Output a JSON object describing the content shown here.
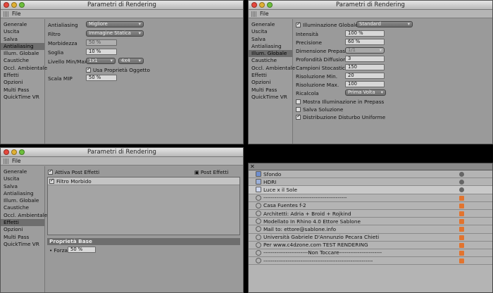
{
  "window_title": "Parametri di Rendering",
  "menu_file": "File",
  "sidebar": [
    "Generale",
    "Uscita",
    "Salva",
    "Antialiasing",
    "Illum. Globale",
    "Caustiche",
    "Occl. Ambientale",
    "Effetti",
    "Opzioni",
    "Multi Pass",
    "QuickTime VR"
  ],
  "win1": {
    "active": 3,
    "antialiasing_label": "Antialiasing",
    "antialiasing_value": "Migliore",
    "filtro_label": "Filtro",
    "filtro_value": "Immagine Statica",
    "morbidezza_label": "Morbidezza",
    "morbidezza_value": "50 %",
    "soglia_label": "Soglia",
    "soglia_value": "10 %",
    "livello_label": "Livello Min/Max",
    "livello_min": "1x1",
    "livello_max": "4x4",
    "usa_label": "Usa Proprietà Oggetto",
    "scala_label": "Scala MIP",
    "scala_value": "50 %"
  },
  "win2": {
    "active": 4,
    "illum_label": "Illuminazione Globale",
    "illum_value": "Standard",
    "intensita_label": "Intensità",
    "intensita_value": "100 %",
    "precisione_label": "Precisione",
    "precisione_value": "60 %",
    "dimensione_label": "Dimensione Prepass",
    "dimensione_value": "1/1",
    "profondita_label": "Profondità Diffusione",
    "profondita_value": "3",
    "campioni_label": "Campioni Stocastici",
    "campioni_value": "150",
    "rismin_label": "Risoluzione Min.",
    "rismin_value": "20",
    "rismax_label": "Risoluzione Max.",
    "rismax_value": "100",
    "ricalcola_label": "Ricalcola",
    "ricalcola_value": "Prima Volta",
    "mostra_label": "Mostra Illuminazione in Prepass",
    "salva_label": "Salva Soluzione",
    "distrib_label": "Distribuzione Disturbo Uniforme"
  },
  "win3": {
    "active": 7,
    "attiva_label": "Attiva Post Effetti",
    "post_effetti_btn": "Post Effetti",
    "filtro_morbido": "Filtro Morbido",
    "proprieta_base": "Proprietà Base",
    "forza_label": "Forza",
    "forza_value": "50 %"
  },
  "objects": [
    "Sfondo",
    "HDRI",
    "Luce x il Sole",
    "---------------------------------------------",
    "Casa Fuentes  f-2",
    "Architetti: Adria + Broid + Rojkind",
    "Modellato In Rhino 4.0  Ettore Sablone",
    "Mail to: ettore@sablone.info",
    "Università  Gabriele D'Annunzio Pecara Chieti",
    "Per www.c4dzone.com TEST RENDERING",
    "------------------------Non Toccare-----------------------",
    "-----------------------------------------------------------"
  ]
}
